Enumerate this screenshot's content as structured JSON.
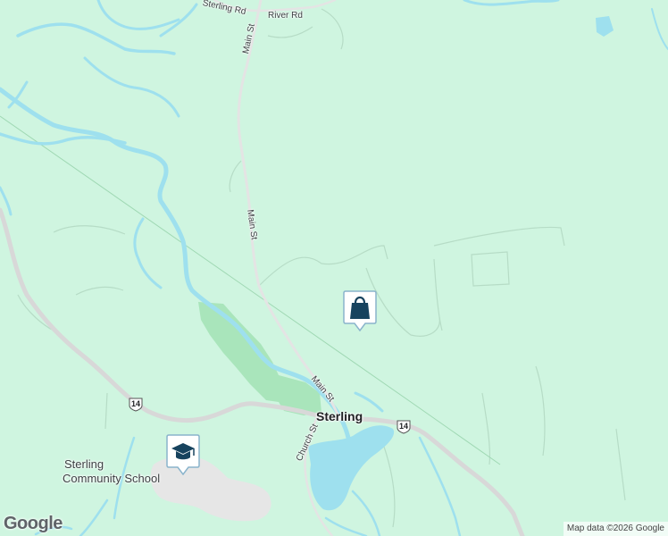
{
  "roads": {
    "sterling_rd": "Sterling Rd",
    "river_rd": "River Rd",
    "main_st_north": "Main St",
    "main_st_mid": "Main St",
    "main_st_south": "Main St",
    "church_st": "Church St"
  },
  "places": {
    "town": "Sterling",
    "school_line1": "Sterling",
    "school_line2": "Community School"
  },
  "route_shield": "14",
  "route_shield_2": "14",
  "markers": {
    "shopping": "shopping-bag-icon",
    "school": "school-icon"
  },
  "colors": {
    "land": "#cff5e0",
    "water": "#9ee0ee",
    "park": "#a9e5bb",
    "highway": "#dcdcdc",
    "marker_fill": "#ffffff",
    "marker_icon": "#17435e"
  },
  "attribution": "Map data ©2026 Google",
  "logo": "Google"
}
